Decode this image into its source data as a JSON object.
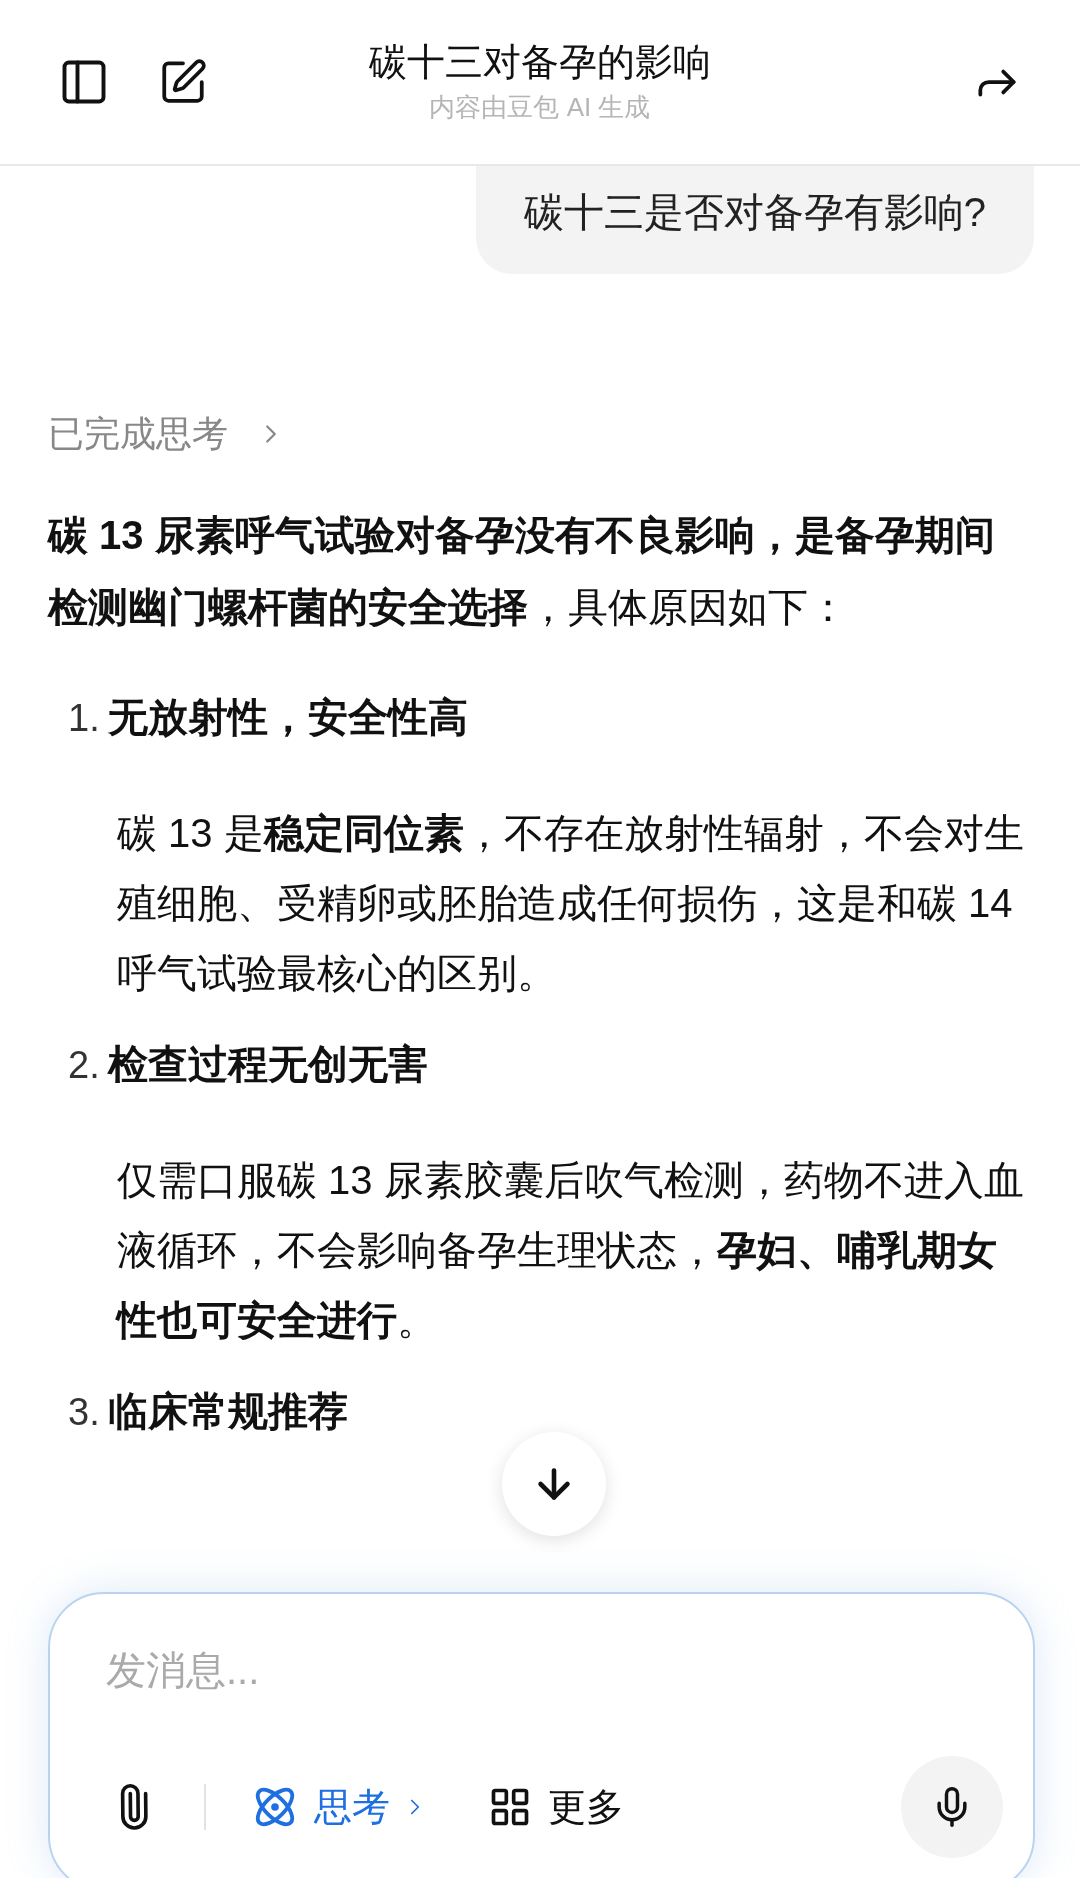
{
  "header": {
    "title": "碳十三对备孕的影响",
    "subtitle": "内容由豆包 AI 生成"
  },
  "user_message": "碳十三是否对备孕有影响?",
  "thinking": {
    "label": "已完成思考",
    "expanded": false
  },
  "answer": {
    "intro": "**碳 13 尿素呼气试验对备孕没有不良影响，是备孕期间检测幽门螺杆菌的安全选择**，具体原因如下：",
    "items": [
      {
        "number": "1.",
        "title": "无放射性，安全性高",
        "body": "碳 13 是**稳定同位素**，不存在放射性辐射，不会对生殖细胞、受精卵或胚胎造成任何损伤，这是和碳 14 呼气试验最核心的区别。"
      },
      {
        "number": "2.",
        "title": "检查过程无创无害",
        "body": "仅需口服碳 13 尿素胶囊后吹气检测，药物不进入血液循环，不会影响备孕生理状态，**孕妇、哺乳期女性也可安全进行**。"
      },
      {
        "number": "3.",
        "title": "临床常规推荐"
      }
    ]
  },
  "composer": {
    "placeholder": "发消息...",
    "tools": [
      {
        "kind": "attach"
      },
      {
        "kind": "think",
        "label": "思考",
        "selected": true
      },
      {
        "kind": "more",
        "label": "更多"
      }
    ]
  }
}
